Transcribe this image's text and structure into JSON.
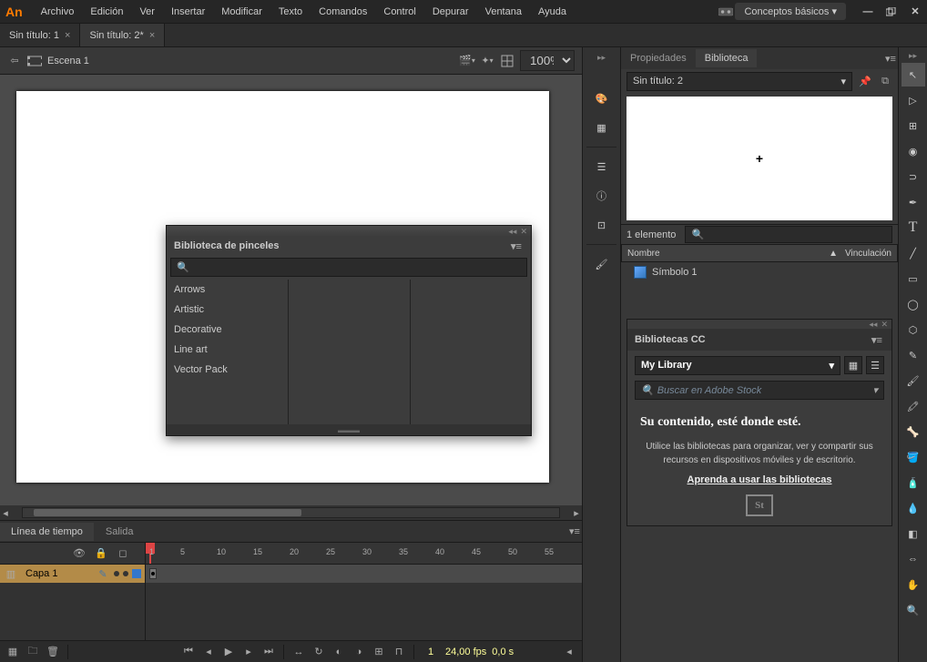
{
  "app": {
    "logo": "An"
  },
  "menu": [
    "Archivo",
    "Edición",
    "Ver",
    "Insertar",
    "Modificar",
    "Texto",
    "Comandos",
    "Control",
    "Depurar",
    "Ventana",
    "Ayuda"
  ],
  "workspace": "Conceptos básicos",
  "tabs": [
    {
      "label": "Sin título: 1",
      "active": false
    },
    {
      "label": "Sin título: 2*",
      "active": true
    }
  ],
  "editbar": {
    "scene": "Escena 1",
    "zoom": "100%"
  },
  "brush_panel": {
    "title": "Biblioteca de pinceles",
    "items": [
      "Arrows",
      "Artistic",
      "Decorative",
      "Line art",
      "Vector Pack"
    ]
  },
  "timeline": {
    "tabs": [
      "Línea de tiempo",
      "Salida"
    ],
    "layer": "Capa 1",
    "ticks": [
      "1",
      "5",
      "10",
      "15",
      "20",
      "25",
      "30",
      "35",
      "40",
      "45",
      "50",
      "55"
    ],
    "status": {
      "frame": "1",
      "fps": "24,00 fps",
      "time": "0,0 s"
    }
  },
  "right": {
    "tabs": [
      "Propiedades",
      "Biblioteca"
    ],
    "doc": "Sin título: 2",
    "status": "1 elemento",
    "cols": {
      "name": "Nombre",
      "link": "Vinculación"
    },
    "item": "Símbolo 1"
  },
  "cc": {
    "title": "Bibliotecas CC",
    "lib": "My Library",
    "search_ph": "Buscar en Adobe Stock",
    "heading": "Su contenido, esté donde esté.",
    "body": "Utilice las bibliotecas para organizar, ver y compartir sus recursos en dispositivos móviles y de escritorio.",
    "link": "Aprenda a usar las bibliotecas",
    "st": "St"
  }
}
